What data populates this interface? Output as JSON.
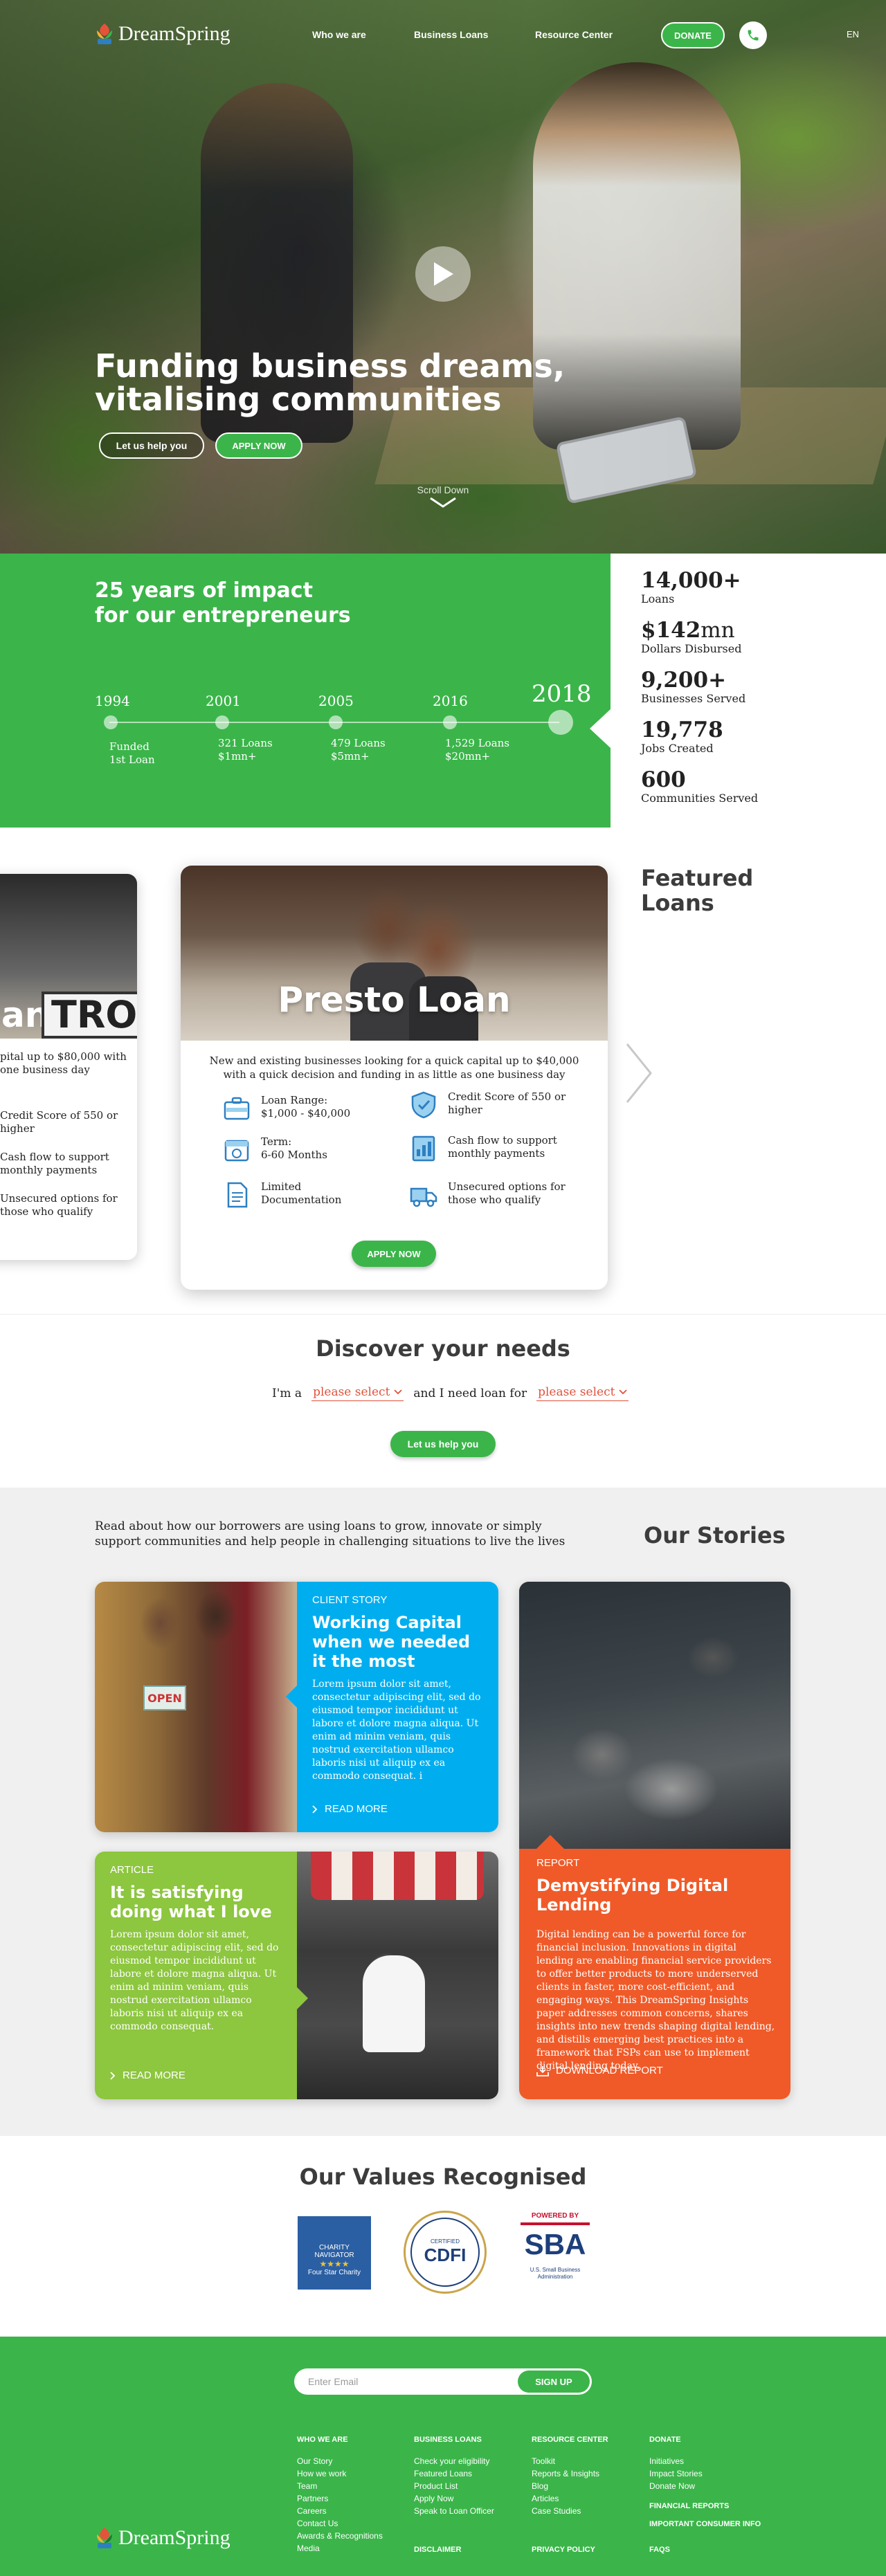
{
  "nav": {
    "logo_text": "DreamSpring",
    "links": [
      "Who we are",
      "Business Loans",
      "Resource Center"
    ],
    "donate_label": "DONATE",
    "lang": "EN"
  },
  "hero": {
    "title_line1": "Funding business dreams,",
    "title_line2": "vitalising communities",
    "help_label": "Let us help you",
    "apply_label": "APPLY NOW",
    "scroll_label": "Scroll Down"
  },
  "impact": {
    "title_line1": "25 years of impact",
    "title_line2": "for our entrepreneurs",
    "timeline": [
      {
        "year": "1994",
        "line1": "Funded",
        "line2": "1st Loan"
      },
      {
        "year": "2001",
        "line1": "321 Loans",
        "line2": "$1mn+"
      },
      {
        "year": "2005",
        "line1": "479 Loans",
        "line2": "$5mn+"
      },
      {
        "year": "2016",
        "line1": "1,529 Loans",
        "line2": "$20mn+"
      },
      {
        "year": "2018",
        "line1": "",
        "line2": ""
      }
    ],
    "stats": [
      {
        "num": "14,000+",
        "unit": "",
        "label": "Loans"
      },
      {
        "num": "$142",
        "unit": "mn",
        "label": "Dollars Disbursed"
      },
      {
        "num": "9,200+",
        "unit": "",
        "label": "Businesses Served"
      },
      {
        "num": "19,778",
        "unit": "",
        "label": "Jobs Created"
      },
      {
        "num": "600",
        "unit": "",
        "label": "Communities Served"
      }
    ]
  },
  "featured": {
    "title_line1": "Featured",
    "title_line2": "Loans",
    "prev_card": {
      "frag_title": "an",
      "sign_text": "TRO",
      "desc_line1": "pital up to $80,000 with",
      "desc_line2": "one business day",
      "f1_line1": "Credit Score of 550 or",
      "f1_line2": "higher",
      "f2_line1": "Cash flow to support",
      "f2_line2": "monthly payments",
      "f3_line1": "Unsecured options for",
      "f3_line2": "those who qualify"
    },
    "presto": {
      "title": "Presto Loan",
      "desc": "New and existing businesses looking for a quick capital up to $40,000 with a quick decision and funding in as little as one business day",
      "features": [
        {
          "line1": "Loan Range:",
          "line2": "$1,000 - $40,000"
        },
        {
          "line1": "Credit Score of 550 or",
          "line2": "higher"
        },
        {
          "line1": "Term:",
          "line2": "6-60 Months"
        },
        {
          "line1": "Cash flow to support",
          "line2": "monthly payments"
        },
        {
          "line1": "Limited",
          "line2": "Documentation"
        },
        {
          "line1": "Unsecured options for",
          "line2": "those who qualify"
        }
      ],
      "apply_label": "APPLY NOW"
    }
  },
  "discover": {
    "title": "Discover your needs",
    "prefix": "I'm a",
    "middle": "and I need loan for",
    "select1": "please select",
    "select2": "please select",
    "help_label": "Let us help you"
  },
  "stories": {
    "intro": "Read about how our borrowers are using loans to grow, innovate or simply support communities and help people in challenging situations to live the lives",
    "title": "Our Stories",
    "story1": {
      "kicker": "Client Story",
      "title": "Working Capital when we needed it the most",
      "body": "Lorem ipsum dolor sit amet, consectetur adipiscing elit, sed do eiusmod tempor incididunt ut labore et dolore magna aliqua. Ut enim ad minim veniam, quis nostrud exercitation ullamco laboris nisi ut aliquip ex ea commodo consequat. i",
      "more": "READ MORE",
      "sign_text": "OPEN"
    },
    "story2": {
      "kicker": "Report",
      "title": "Demystifying Digital Lending",
      "body": "Digital lending can be a powerful force for financial inclusion. Innovations in digital lending are enabling financial service providers to offer better products to more underserved clients in faster, more cost-efficient, and engaging ways. This DreamSpring Insights paper addresses common concerns, shares insights into new trends shaping digital lending, and distills emerging best practices into a framework that FSPs can use to implement digital lending today.",
      "more": "DOWNLOAD REPORT"
    },
    "story3": {
      "kicker": "Article",
      "title": "It is satisfying doing what I love",
      "body": "Lorem ipsum dolor sit amet, consectetur adipiscing elit, sed do eiusmod tempor incididunt ut labore et dolore magna aliqua. Ut enim ad minim veniam, quis nostrud exercitation ullamco laboris nisi ut aliquip ex ea commodo consequat.",
      "more": "READ MORE"
    }
  },
  "values": {
    "title": "Our Values Recognised",
    "charity": {
      "line1": "CHARITY",
      "line2": "NAVIGATOR",
      "stars": "★★★★",
      "line3": "Four Star Charity"
    },
    "cdfi": {
      "top": "CERTIFIED",
      "big": "CDFI"
    },
    "sba": {
      "powered": "POWERED BY",
      "logo": "SBA",
      "sub1": "U.S. Small Business",
      "sub2": "Administration"
    }
  },
  "footer": {
    "email_placeholder": "Enter Email",
    "signup_label": "SIGN UP",
    "columns": [
      {
        "head": "WHO WE ARE",
        "links": [
          "Our Story",
          "How we work",
          "Team",
          "Partners",
          "Careers",
          "Contact Us",
          "Awards & Recognitions",
          "Media"
        ]
      },
      {
        "head": "BUSINESS LOANS",
        "links": [
          "Check your eligibility",
          "Featured Loans",
          "Product List",
          "Apply Now",
          "Speak to Loan Officer"
        ]
      },
      {
        "head": "RESOURCE CENTER",
        "links": [
          "Toolkit",
          "Reports & Insights",
          "Blog",
          "Articles",
          "Case Studies"
        ]
      },
      {
        "head": "DONATE",
        "links": [
          "Initiatives",
          "Impact Stories",
          "Donate Now"
        ],
        "extra1": "FINANCIAL REPORTS",
        "extra2": "IMPORTANT CONSUMER INFO"
      }
    ],
    "logo_text": "DreamSpring",
    "bottom": [
      "DISCLAIMER",
      "PRIVACY POLICY",
      "FAQS"
    ]
  },
  "colors": {
    "brand_green": "#3bb54a",
    "story_blue": "#00aeef",
    "story_orange": "#f05a28",
    "story_lime": "#8dc63f",
    "select_red": "#e0533b"
  }
}
